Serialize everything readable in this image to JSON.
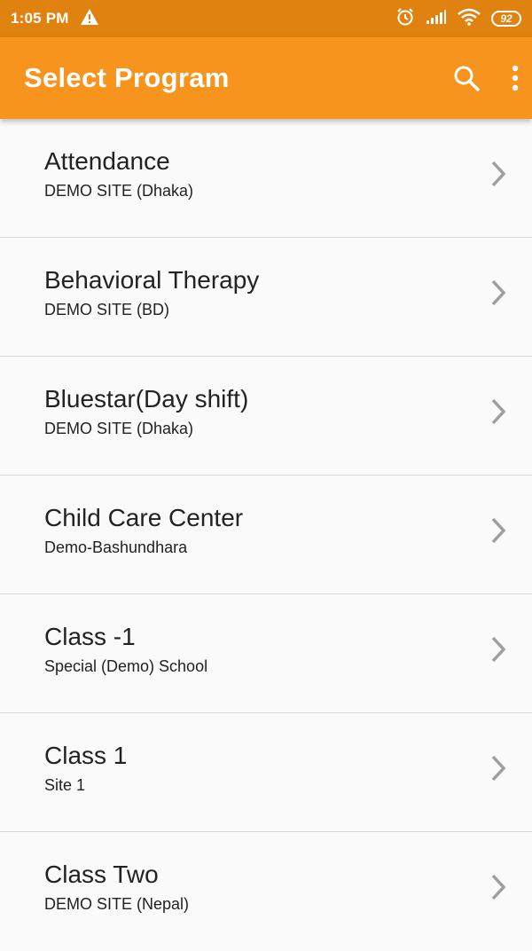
{
  "status_bar": {
    "time": "1:05 PM",
    "battery_level": "92",
    "icons": [
      "warning-icon",
      "alarm-icon",
      "signal-icon",
      "wifi-icon",
      "battery-icon"
    ]
  },
  "app_bar": {
    "title": "Select Program",
    "background_color": "#f7941d",
    "actions": [
      "search-icon",
      "more-vert-icon"
    ]
  },
  "programs": [
    {
      "name": "Attendance",
      "site": "DEMO SITE (Dhaka)"
    },
    {
      "name": "Behavioral Therapy",
      "site": "DEMO SITE (BD)"
    },
    {
      "name": "Bluestar(Day shift)",
      "site": "DEMO SITE (Dhaka)"
    },
    {
      "name": "Child Care Center",
      "site": "Demo-Bashundhara"
    },
    {
      "name": "Class -1",
      "site": "Special (Demo) School"
    },
    {
      "name": "Class 1",
      "site": "Site 1"
    },
    {
      "name": "Class Two",
      "site": "DEMO SITE (Nepal)"
    }
  ]
}
